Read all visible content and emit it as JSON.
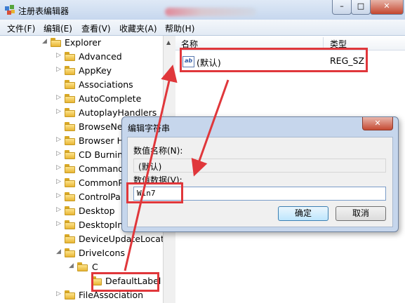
{
  "window": {
    "title": "注册表编辑器",
    "minimize": "–",
    "maximize": "□",
    "close": "✕"
  },
  "menu": [
    "文件(F)",
    "编辑(E)",
    "查看(V)",
    "收藏夹(A)",
    "帮助(H)"
  ],
  "tree": {
    "items": [
      {
        "label": "Explorer",
        "expander": "◢",
        "expanded": true
      },
      {
        "label": "Advanced",
        "expander": "▷"
      },
      {
        "label": "AppKey",
        "expander": "▷"
      },
      {
        "label": "Associations",
        "expander": ""
      },
      {
        "label": "AutoComplete",
        "expander": "▷"
      },
      {
        "label": "AutoplayHandlers",
        "expander": "▷"
      },
      {
        "label": "BrowseNewProcess",
        "expander": ""
      },
      {
        "label": "Browser Helper Objects",
        "expander": "▷"
      },
      {
        "label": "CD Burning",
        "expander": "▷"
      },
      {
        "label": "CommandStore",
        "expander": "▷"
      },
      {
        "label": "CommonPlaces",
        "expander": "▷"
      },
      {
        "label": "ControlPanel",
        "expander": "▷"
      },
      {
        "label": "Desktop",
        "expander": "▷"
      },
      {
        "label": "DesktopIni",
        "expander": "▷"
      },
      {
        "label": "DeviceUpdateLocations",
        "expander": ""
      },
      {
        "label": "DriveIcons",
        "expander": "◢",
        "expanded": true
      },
      {
        "label": "C",
        "expander": "◢",
        "expanded": true
      },
      {
        "label": "DefaultLabel",
        "expander": "",
        "selected": true
      },
      {
        "label": "FileAssociation",
        "expander": "▷"
      }
    ]
  },
  "list": {
    "columns": {
      "name": "名称",
      "type": "类型"
    },
    "rows": [
      {
        "icon": "ab",
        "name": "(默认)",
        "type": "REG_SZ"
      }
    ]
  },
  "dialog": {
    "title": "编辑字符串",
    "close": "✕",
    "name_label": "数值名称(N):",
    "name_value": "(默认)",
    "data_label": "数值数据(V):",
    "data_value": "Win7",
    "ok": "确定",
    "cancel": "取消"
  },
  "colors": {
    "highlight": "#e0373b"
  }
}
